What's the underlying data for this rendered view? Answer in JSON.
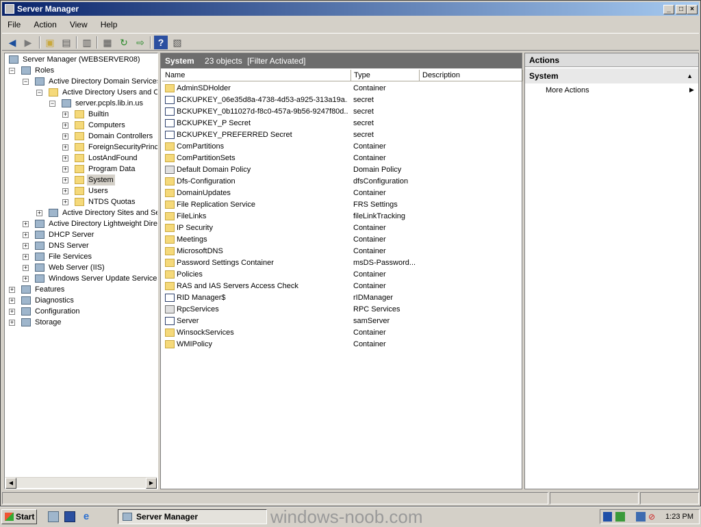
{
  "window": {
    "title": "Server Manager"
  },
  "menu": [
    "File",
    "Action",
    "View",
    "Help"
  ],
  "tree": {
    "root": "Server Manager (WEBSERVER08)",
    "nodes": [
      {
        "label": "Roles"
      },
      {
        "label": "Active Directory Domain Services"
      },
      {
        "label": "Active Directory Users and Co"
      },
      {
        "label": "server.pcpls.lib.in.us"
      },
      {
        "label": "Builtin"
      },
      {
        "label": "Computers"
      },
      {
        "label": "Domain Controllers"
      },
      {
        "label": "ForeignSecurityPrincip"
      },
      {
        "label": "LostAndFound"
      },
      {
        "label": "Program Data"
      },
      {
        "label": "System"
      },
      {
        "label": "Users"
      },
      {
        "label": "NTDS Quotas"
      },
      {
        "label": "Active Directory Sites and Ser"
      },
      {
        "label": "Active Directory Lightweight Direc"
      },
      {
        "label": "DHCP Server"
      },
      {
        "label": "DNS Server"
      },
      {
        "label": "File Services"
      },
      {
        "label": "Web Server (IIS)"
      },
      {
        "label": "Windows Server Update Services"
      },
      {
        "label": "Features"
      },
      {
        "label": "Diagnostics"
      },
      {
        "label": "Configuration"
      },
      {
        "label": "Storage"
      }
    ]
  },
  "center": {
    "title": "System",
    "count": "23 objects",
    "filter": "[Filter Activated]",
    "columns": [
      "Name",
      "Type",
      "Description"
    ],
    "rows": [
      {
        "name": "AdminSDHolder",
        "type": "Container",
        "icon": "folder"
      },
      {
        "name": "BCKUPKEY_06e35d8a-4738-4d53-a925-313a19a...",
        "type": "secret",
        "icon": "secret"
      },
      {
        "name": "BCKUPKEY_0b11027d-f8c0-457a-9b56-9247f80d...",
        "type": "secret",
        "icon": "secret"
      },
      {
        "name": "BCKUPKEY_P Secret",
        "type": "secret",
        "icon": "secret"
      },
      {
        "name": "BCKUPKEY_PREFERRED Secret",
        "type": "secret",
        "icon": "secret"
      },
      {
        "name": "ComPartitions",
        "type": "Container",
        "icon": "folder"
      },
      {
        "name": "ComPartitionSets",
        "type": "Container",
        "icon": "folder"
      },
      {
        "name": "Default Domain Policy",
        "type": "Domain Policy",
        "icon": "policy"
      },
      {
        "name": "Dfs-Configuration",
        "type": "dfsConfiguration",
        "icon": "folder"
      },
      {
        "name": "DomainUpdates",
        "type": "Container",
        "icon": "folder"
      },
      {
        "name": "File Replication Service",
        "type": "FRS Settings",
        "icon": "frs"
      },
      {
        "name": "FileLinks",
        "type": "fileLinkTracking",
        "icon": "folder"
      },
      {
        "name": "IP Security",
        "type": "Container",
        "icon": "folder"
      },
      {
        "name": "Meetings",
        "type": "Container",
        "icon": "folder"
      },
      {
        "name": "MicrosoftDNS",
        "type": "Container",
        "icon": "folder"
      },
      {
        "name": "Password Settings Container",
        "type": "msDS-Password...",
        "icon": "folder"
      },
      {
        "name": "Policies",
        "type": "Container",
        "icon": "folder"
      },
      {
        "name": "RAS and IAS Servers Access Check",
        "type": "Container",
        "icon": "folder"
      },
      {
        "name": "RID Manager$",
        "type": "rIDManager",
        "icon": "secret"
      },
      {
        "name": "RpcServices",
        "type": "RPC Services",
        "icon": "generic"
      },
      {
        "name": "Server",
        "type": "samServer",
        "icon": "secret"
      },
      {
        "name": "WinsockServices",
        "type": "Container",
        "icon": "folder"
      },
      {
        "name": "WMIPolicy",
        "type": "Container",
        "icon": "folder"
      }
    ]
  },
  "actions": {
    "header": "Actions",
    "section": "System",
    "items": [
      "More Actions"
    ]
  },
  "taskbar": {
    "start": "Start",
    "window": "Server Manager",
    "watermark": "windows-noob.com",
    "clock": "1:23 PM"
  }
}
